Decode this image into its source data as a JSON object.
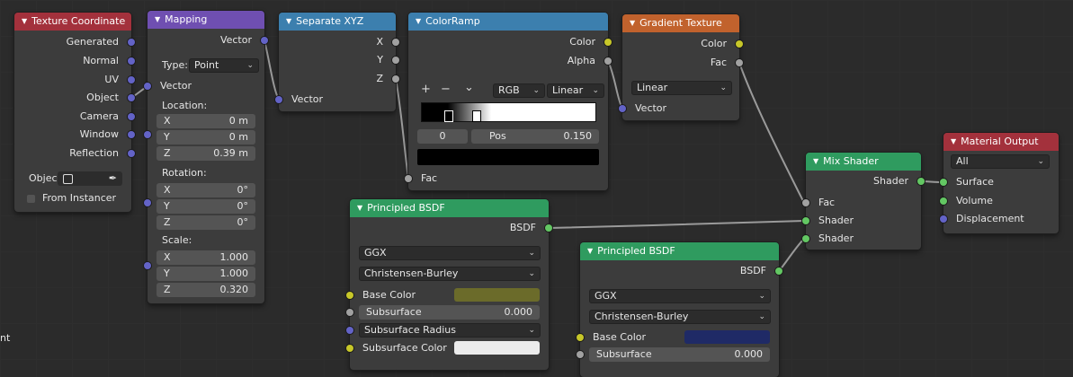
{
  "nodes": {
    "texture_coordinate": {
      "title": "Texture Coordinate",
      "outputs": [
        "Generated",
        "Normal",
        "UV",
        "Object",
        "Camera",
        "Window",
        "Reflection"
      ],
      "object_label": "Objec",
      "from_instancer": "From Instancer"
    },
    "mapping": {
      "title": "Mapping",
      "output": "Vector",
      "type_label": "Type:",
      "type_value": "Point",
      "vector_input": "Vector",
      "location_label": "Location:",
      "location": [
        {
          "axis": "X",
          "value": "0 m"
        },
        {
          "axis": "Y",
          "value": "0 m"
        },
        {
          "axis": "Z",
          "value": "0.39 m"
        }
      ],
      "rotation_label": "Rotation:",
      "rotation": [
        {
          "axis": "X",
          "value": "0°"
        },
        {
          "axis": "Y",
          "value": "0°"
        },
        {
          "axis": "Z",
          "value": "0°"
        }
      ],
      "scale_label": "Scale:",
      "scale": [
        {
          "axis": "X",
          "value": "1.000"
        },
        {
          "axis": "Y",
          "value": "1.000"
        },
        {
          "axis": "Z",
          "value": "0.320"
        }
      ]
    },
    "separate_xyz": {
      "title": "Separate XYZ",
      "outputs": [
        "X",
        "Y",
        "Z"
      ],
      "input": "Vector"
    },
    "color_ramp": {
      "title": "ColorRamp",
      "outputs": [
        "Color",
        "Alpha"
      ],
      "add_btn": "+",
      "remove_btn": "−",
      "menu_btn": "⌄",
      "color_mode": "RGB",
      "interpolation": "Linear",
      "index_value": "0",
      "pos_label": "Pos",
      "pos_value": "0.150",
      "fac_input": "Fac"
    },
    "gradient_texture": {
      "title": "Gradient Texture",
      "outputs": [
        "Color",
        "Fac"
      ],
      "type_value": "Linear",
      "vector_input": "Vector"
    },
    "principled_1": {
      "title": "Principled BSDF",
      "output": "BSDF",
      "distribution": "GGX",
      "subsurface_method": "Christensen-Burley",
      "base_color_label": "Base Color",
      "base_color": "#6b6b2a",
      "subsurface_label": "Subsurface",
      "subsurface_value": "0.000",
      "subsurface_radius_label": "Subsurface Radius",
      "subsurface_color_label": "Subsurface Color",
      "subsurface_color": "#ececec"
    },
    "principled_2": {
      "title": "Principled BSDF",
      "output": "BSDF",
      "distribution": "GGX",
      "subsurface_method": "Christensen-Burley",
      "base_color_label": "Base Color",
      "base_color": "#1f2a66",
      "subsurface_label": "Subsurface",
      "subsurface_value": "0.000"
    },
    "mix_shader": {
      "title": "Mix Shader",
      "output": "Shader",
      "inputs": [
        "Fac",
        "Shader",
        "Shader"
      ]
    },
    "material_output": {
      "title": "Material Output",
      "target": "All",
      "inputs": [
        "Surface",
        "Volume",
        "Displacement"
      ]
    }
  },
  "edge_text": "nt",
  "colors": {
    "vector_socket": "#6363c7",
    "float_socket": "#a1a1a1",
    "color_socket": "#c7c729",
    "shader_socket": "#63c763"
  }
}
